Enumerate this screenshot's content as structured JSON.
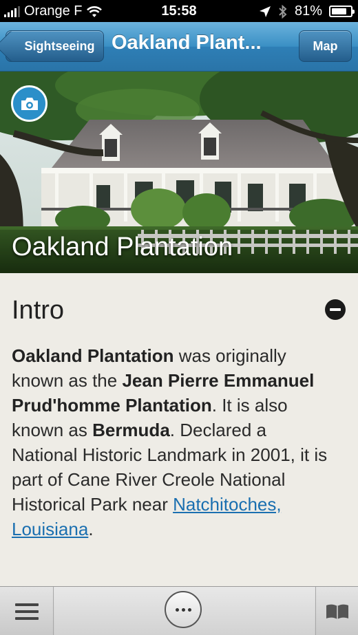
{
  "status_bar": {
    "carrier": "Orange F",
    "time": "15:58",
    "battery_percent": "81%",
    "battery_level": 0.81,
    "icons": [
      "signal-bars-icon",
      "wifi-icon",
      "location-arrow-icon",
      "bluetooth-icon",
      "battery-icon"
    ]
  },
  "nav": {
    "back_label": "Sightseeing",
    "title": "Oakland Plant...",
    "map_label": "Map"
  },
  "hero": {
    "title": "Oakland Plantation",
    "camera_icon": "camera-icon"
  },
  "intro": {
    "heading": "Intro",
    "collapse_icon": "minus-circle-icon",
    "b1": "Oakland Plantation",
    "t1": " was originally known as the ",
    "b2": "Jean Pierre Emmanuel Prud'homme Plantation",
    "t2": ". It is also known as ",
    "b3": "Bermuda",
    "t3": ". Declared a National Historic Landmark in 2001, it is part of Cane River Creole National Historical Park near ",
    "link": "Natchitoches, Louisiana",
    "t4": "."
  },
  "toolbar": {
    "icons": [
      "menu-icon",
      "more-icon",
      "book-icon"
    ]
  },
  "colors": {
    "nav_blue": "#3a8fc4",
    "link_blue": "#1a6fb0",
    "camera_blue": "#2b8fc9",
    "content_bg": "#eeece6"
  }
}
